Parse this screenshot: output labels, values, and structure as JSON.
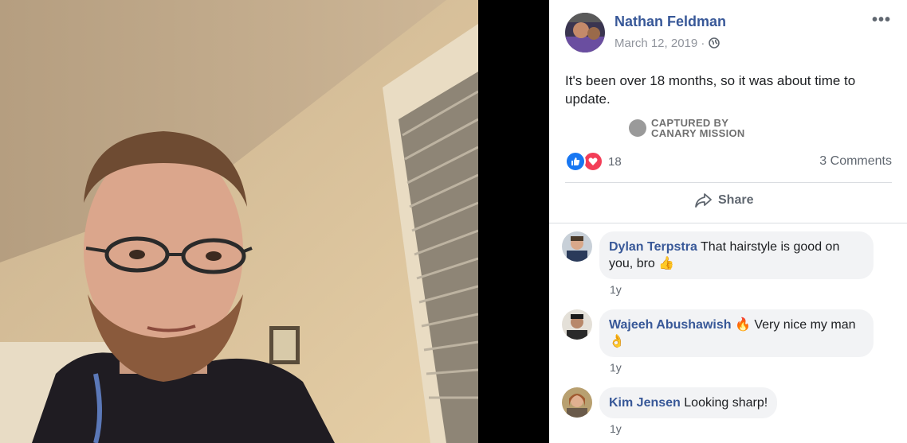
{
  "post": {
    "author": "Nathan Feldman",
    "date": "March 12, 2019 ·",
    "more": "•••",
    "text": "It's been over 18 months, so it was about time to update.",
    "watermark_line1": "CAPTURED BY",
    "watermark_line2": "CANARY MISSION",
    "reaction_count": "18",
    "comments_label": "3 Comments",
    "share_label": "Share"
  },
  "comments": [
    {
      "name": "Dylan Terpstra",
      "text": "That hairstyle is good on you, bro 👍",
      "time": "1y"
    },
    {
      "name": "Wajeeh Abushawish",
      "text": "🔥 Very nice my man 👌",
      "time": "1y"
    },
    {
      "name": "Kim Jensen",
      "text": "Looking sharp!",
      "time": "1y"
    }
  ],
  "colors": {
    "link_blue": "#385898",
    "like_blue": "#1877f2",
    "love_red": "#f33e58",
    "bubble_bg": "#f2f3f5"
  },
  "icons": [
    "globe-icon",
    "more-icon",
    "like-icon",
    "love-icon",
    "share-icon",
    "canary-logo-icon"
  ]
}
